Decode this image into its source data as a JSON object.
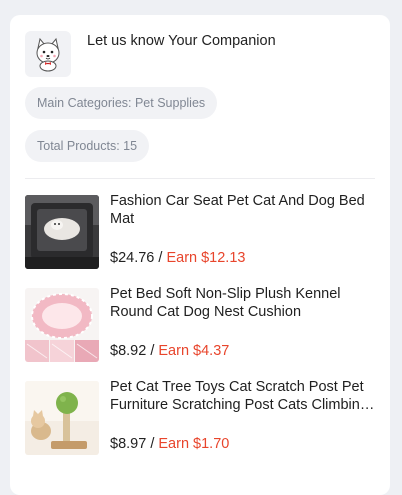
{
  "store": {
    "name": "Let us know Your Companion",
    "logo_icon": "samoyed-dog-logo"
  },
  "pills": {
    "category": "Main Categories: Pet Supplies",
    "total": "Total Products: 15"
  },
  "products": [
    {
      "title": "Fashion Car Seat Pet Cat And Dog Bed Mat",
      "price": "$24.76",
      "separator": " / ",
      "earn": "Earn $12.13",
      "image_icon": "car-seat-pet-bed-image"
    },
    {
      "title": "Pet Bed Soft Non-Slip Plush Kennel Round Cat Dog Nest Cushion",
      "price": "$8.92",
      "separator": " / ",
      "earn": "Earn $4.37",
      "image_icon": "plush-pet-bed-image"
    },
    {
      "title": "Pet Cat Tree Toys Cat Scratch Post Pet Furniture Scratching Post Cats Climbing Tree",
      "price": "$8.97",
      "separator": " / ",
      "earn": "Earn $1.70",
      "image_icon": "cat-tree-image"
    }
  ],
  "colors": {
    "earn": "#e8452c",
    "background": "#eef0f4",
    "pill_bg": "#f1f2f5"
  }
}
